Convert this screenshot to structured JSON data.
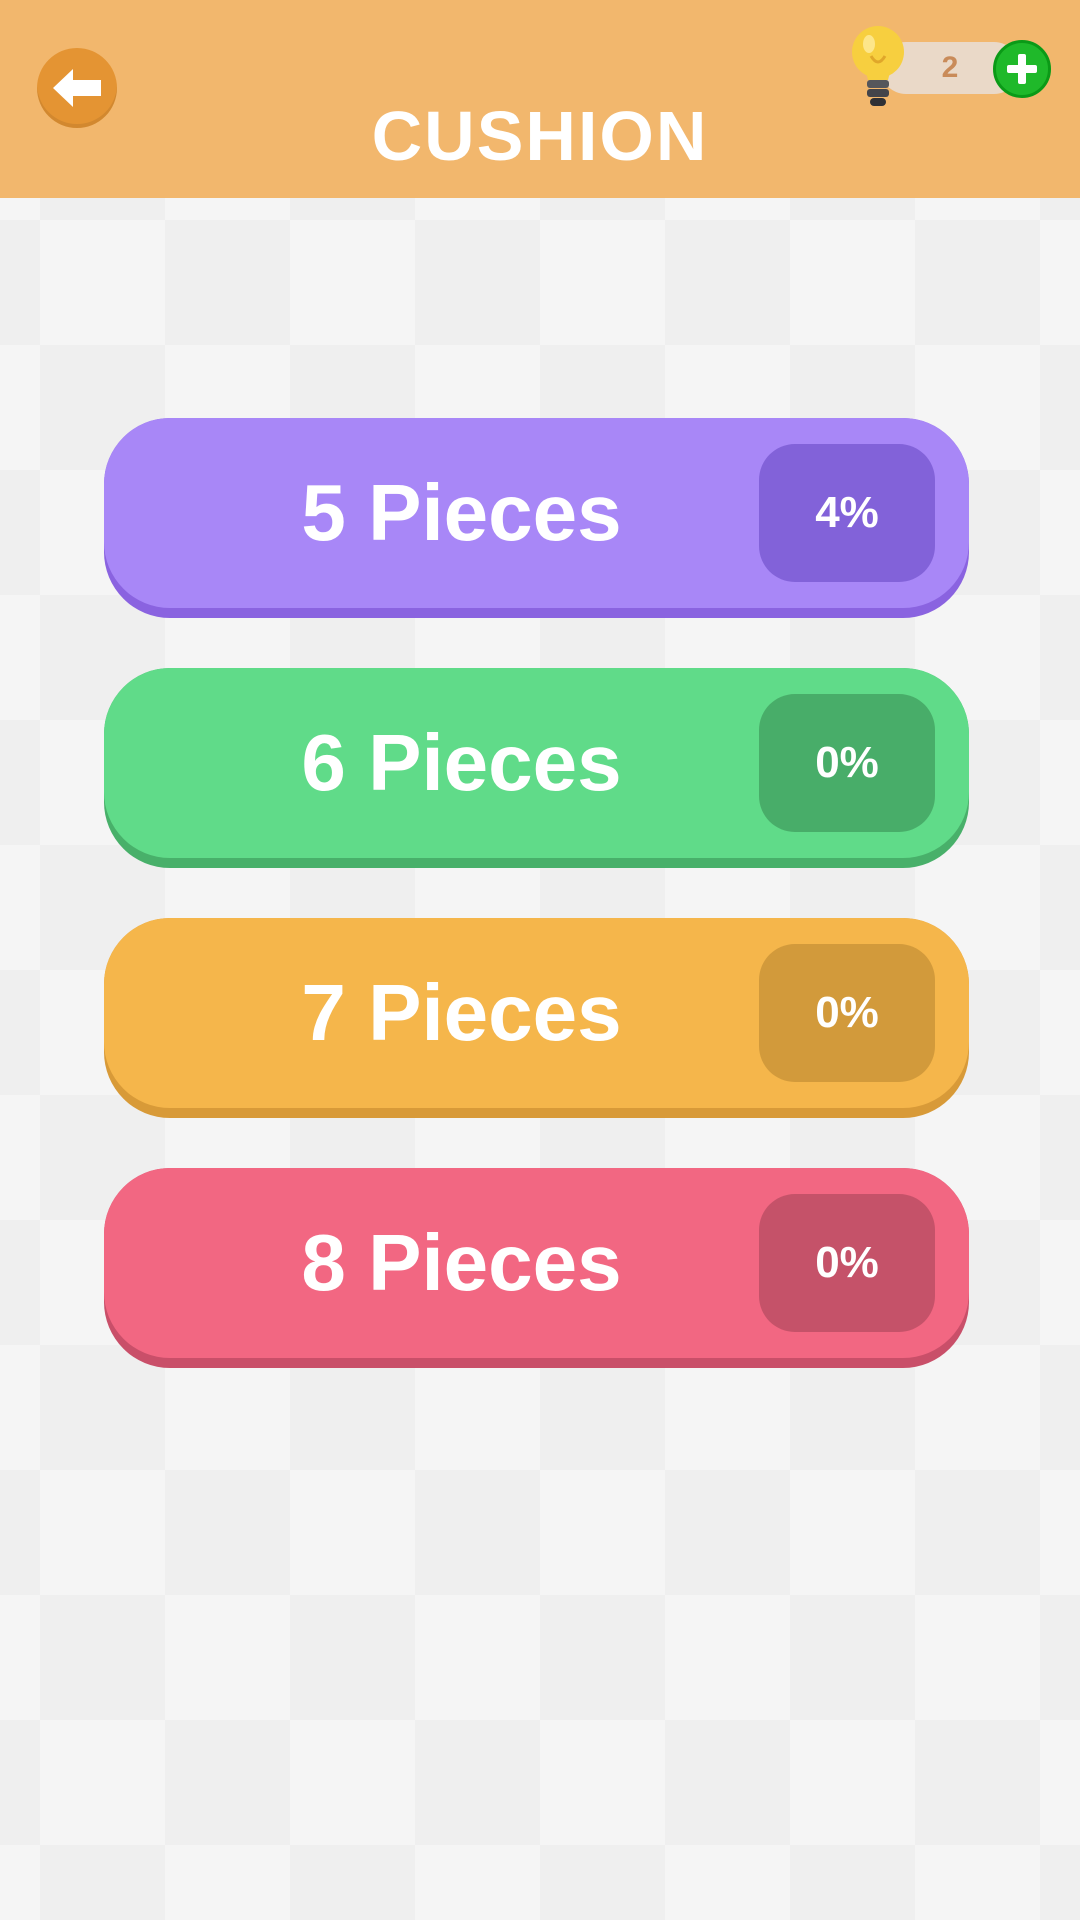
{
  "header": {
    "title": "CUSHION",
    "hint_count": "2"
  },
  "levels": [
    {
      "label": "5 Pieces",
      "progress": "4%",
      "color": "#a887f7",
      "shadow": "#8a63e0",
      "badge": "#8262d9"
    },
    {
      "label": "6 Pieces",
      "progress": "0%",
      "color": "#60db89",
      "shadow": "#48b06a",
      "badge": "#48ad69"
    },
    {
      "label": "7 Pieces",
      "progress": "0%",
      "color": "#f5b64b",
      "shadow": "#d89a38",
      "badge": "#d29a3b"
    },
    {
      "label": "8 Pieces",
      "progress": "0%",
      "color": "#f26782",
      "shadow": "#c94f69",
      "badge": "#c55269"
    }
  ],
  "icons": {
    "back": "arrow-left-icon",
    "hint": "lightbulb-icon",
    "add": "plus-icon"
  }
}
